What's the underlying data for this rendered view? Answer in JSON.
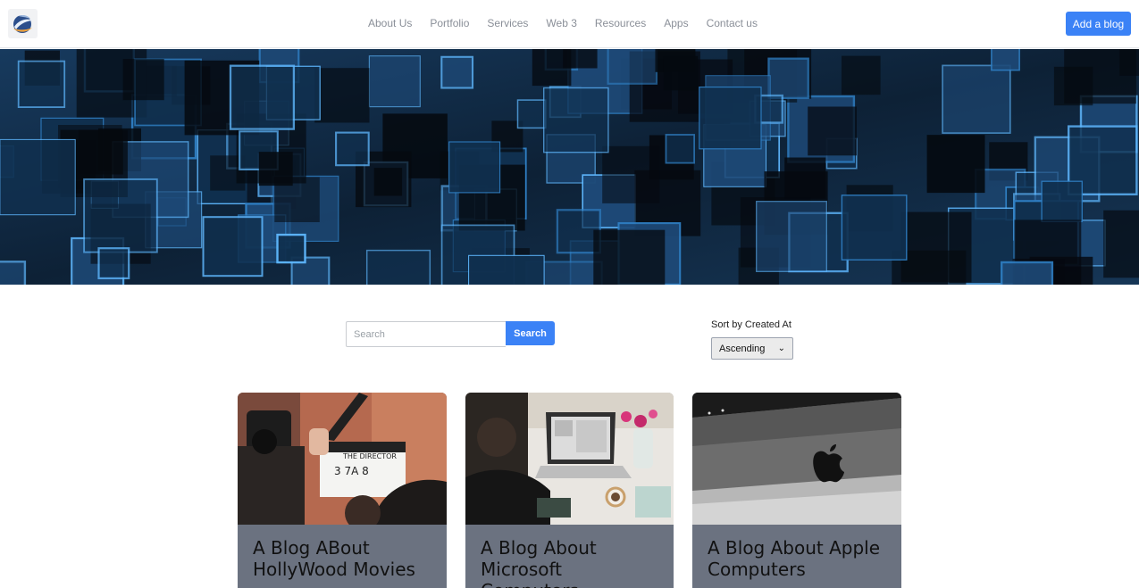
{
  "header": {
    "logo_icon": "globe-logo-icon",
    "nav": [
      {
        "label": "About Us"
      },
      {
        "label": "Portfolio"
      },
      {
        "label": "Services"
      },
      {
        "label": "Web 3"
      },
      {
        "label": "Resources"
      },
      {
        "label": "Apps"
      },
      {
        "label": "Contact us"
      }
    ],
    "add_blog_label": "Add a blog"
  },
  "hero": {
    "image": "glowing-blue-circuit-squares-banner"
  },
  "search": {
    "placeholder": "Search",
    "value": "",
    "button_label": "Search"
  },
  "sort": {
    "label": "Sort by Created At",
    "selected": "Ascending"
  },
  "cards": [
    {
      "title": "A Blog ABout HollyWood Movies",
      "image": "film-clapperboard-camera-photo"
    },
    {
      "title": "A Blog About Microsoft Computers",
      "image": "woman-laptop-desk-flowers-photo"
    },
    {
      "title": "A Blog About Apple Computers",
      "image": "imac-apple-logo-photo"
    }
  ],
  "colors": {
    "accent": "#3b82f6",
    "card_footer": "#6b7280",
    "nav_text": "#8a8f98"
  }
}
